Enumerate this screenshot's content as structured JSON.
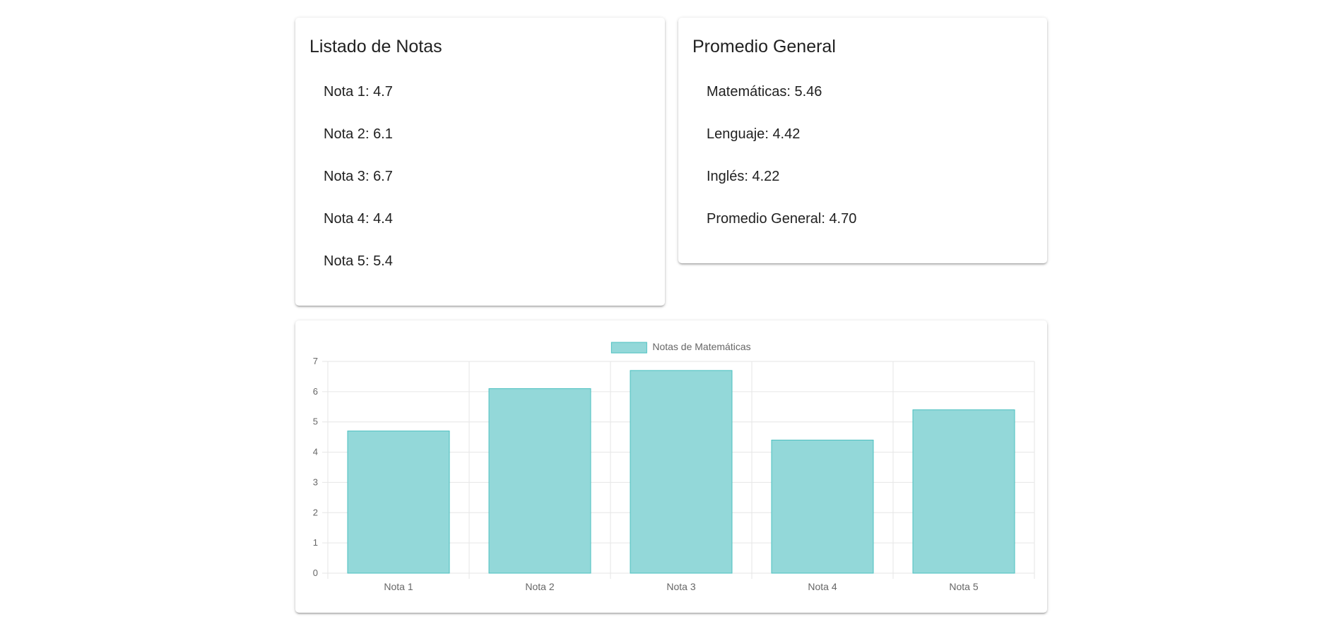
{
  "notas_card": {
    "title": "Listado de Notas",
    "items": [
      {
        "label": "Nota 1",
        "value": "4.7"
      },
      {
        "label": "Nota 2",
        "value": "6.1"
      },
      {
        "label": "Nota 3",
        "value": "6.7"
      },
      {
        "label": "Nota 4",
        "value": "4.4"
      },
      {
        "label": "Nota 5",
        "value": "5.4"
      }
    ]
  },
  "promedio_card": {
    "title": "Promedio General",
    "items": [
      {
        "label": "Matemáticas",
        "value": "5.46"
      },
      {
        "label": "Lenguaje",
        "value": "4.42"
      },
      {
        "label": "Inglés",
        "value": "4.22"
      },
      {
        "label": "Promedio General",
        "value": "4.70"
      }
    ]
  },
  "colors": {
    "bar_fill": "#93d8d9",
    "bar_border": "#4bc0c0",
    "grid": "#e6e6e6",
    "tick_text": "#666666"
  },
  "chart_data": {
    "type": "bar",
    "categories": [
      "Nota 1",
      "Nota 2",
      "Nota 3",
      "Nota 4",
      "Nota 5"
    ],
    "series": [
      {
        "name": "Notas de Matemáticas",
        "values": [
          4.7,
          6.1,
          6.7,
          4.4,
          5.4
        ]
      }
    ],
    "title": "",
    "xlabel": "",
    "ylabel": "",
    "ylim": [
      0,
      7
    ],
    "yticks": [
      0,
      1,
      2,
      3,
      4,
      5,
      6,
      7
    ],
    "grid": true,
    "legend": "top-center"
  }
}
